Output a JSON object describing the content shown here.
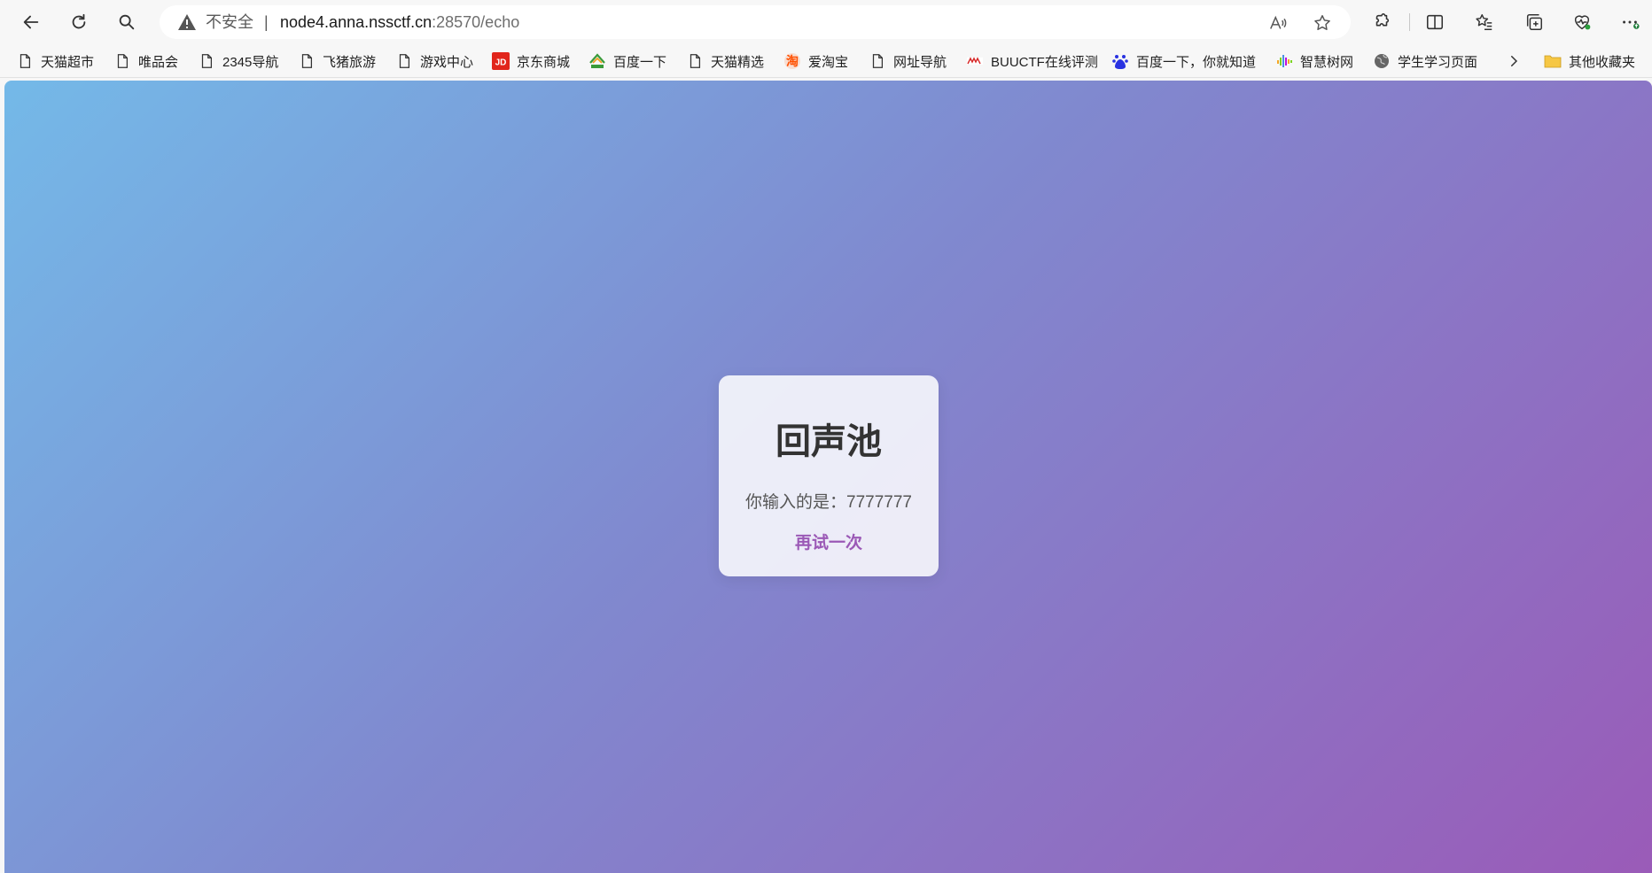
{
  "browser": {
    "security_label": "不安全",
    "separator": "|",
    "url_host": "node4.anna.nssctf.cn",
    "url_path": ":28570/echo",
    "icons": {
      "back": "back-arrow-icon",
      "reload": "reload-icon",
      "search": "search-icon",
      "warning": "warning-icon",
      "read_aloud": "read-aloud-icon",
      "favorite": "star-icon",
      "extensions": "puzzle-icon",
      "split_screen": "split-screen-icon",
      "favorites": "favorites-icon",
      "collections": "collections-icon",
      "health": "heart-pulse-icon",
      "menu": "more-icon"
    }
  },
  "bookmarks": [
    {
      "label": "天猫超市",
      "icon": "page-icon"
    },
    {
      "label": "唯品会",
      "icon": "page-icon"
    },
    {
      "label": "2345导航",
      "icon": "page-icon"
    },
    {
      "label": "飞猪旅游",
      "icon": "page-icon"
    },
    {
      "label": "游戏中心",
      "icon": "page-icon"
    },
    {
      "label": "京东商城",
      "icon": "jd-icon"
    },
    {
      "label": "百度一下",
      "icon": "2345-icon"
    },
    {
      "label": "天猫精选",
      "icon": "page-icon"
    },
    {
      "label": "爱淘宝",
      "icon": "taobao-icon"
    },
    {
      "label": "网址导航",
      "icon": "page-icon"
    },
    {
      "label": "BUUCTF在线评测",
      "icon": "buuctf-icon"
    },
    {
      "label": "百度一下，你就知道",
      "icon": "baidu-icon"
    },
    {
      "label": "智慧树网",
      "icon": "zhihuishu-icon"
    },
    {
      "label": "学生学习页面",
      "icon": "globe-icon"
    },
    {
      "label": "其他收藏夹",
      "icon": "folder-icon"
    }
  ],
  "page": {
    "title": "回声池",
    "echo_text": "你输入的是：7777777",
    "retry_link": "再试一次"
  },
  "colors": {
    "gradient_start": "#74b9e8",
    "gradient_end": "#9a5bb8",
    "link": "#9b59b6",
    "title": "#333333"
  }
}
